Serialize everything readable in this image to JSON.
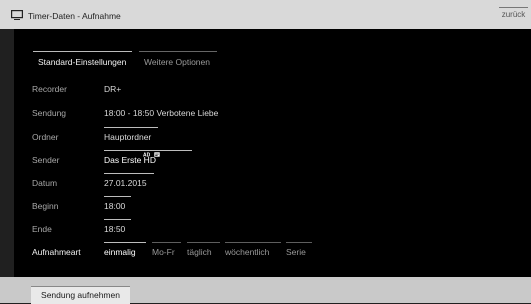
{
  "header": {
    "title": "Timer-Daten - Aufnahme",
    "back_label": "zurück"
  },
  "tabs": [
    {
      "label": "Standard-Einstellungen",
      "active": true
    },
    {
      "label": "Weitere Optionen",
      "active": false
    }
  ],
  "rows": {
    "recorder": {
      "label": "Recorder",
      "value": "DR+"
    },
    "sendung": {
      "label": "Sendung",
      "value": "18:00 - 18:50 Verbotene Liebe"
    },
    "ordner": {
      "label": "Ordner",
      "value": "Hauptordner"
    },
    "sender": {
      "label": "Sender",
      "value": "Das Erste HD",
      "icons": [
        "audio-description-icon",
        "subtitle-icon"
      ]
    },
    "datum": {
      "label": "Datum",
      "value": "27.01.2015"
    },
    "beginn": {
      "label": "Beginn",
      "value": "18:00"
    },
    "ende": {
      "label": "Ende",
      "value": "18:50"
    },
    "aufnahmeart": {
      "label": "Aufnahmeart",
      "options": [
        "einmalig",
        "Mo-Fr",
        "täglich",
        "wöchentlich",
        "Serie"
      ],
      "selected": "einmalig"
    }
  },
  "footer": {
    "record_button": "Sendung aufnehmen"
  }
}
